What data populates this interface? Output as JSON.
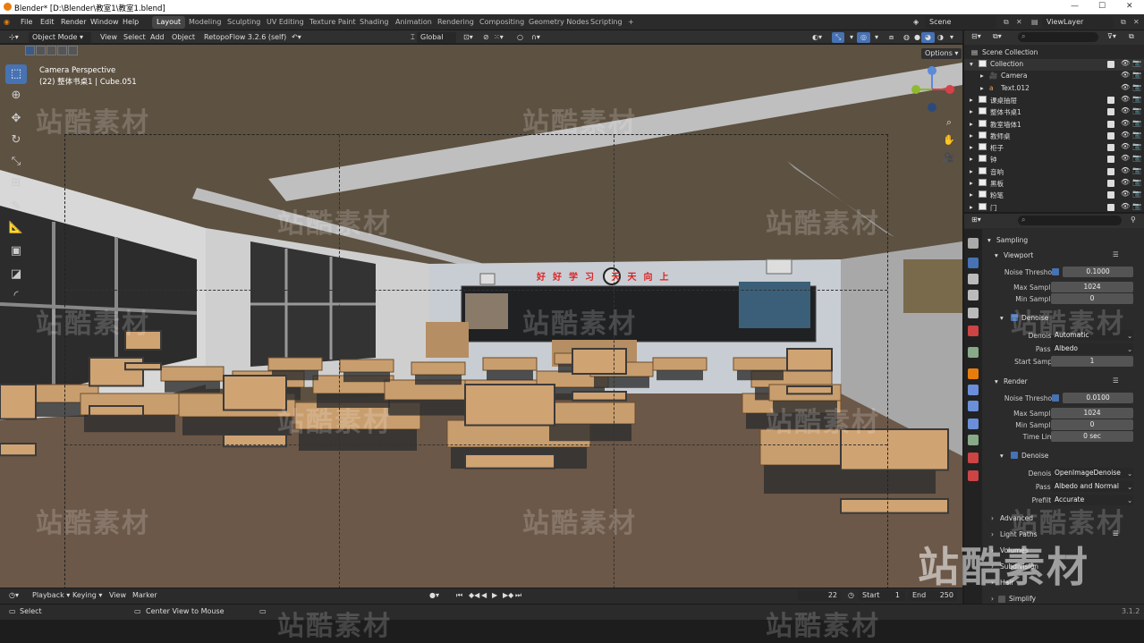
{
  "titlebar": {
    "title": "Blender* [D:\\Blender\\教室1\\教室1.blend]"
  },
  "menu": {
    "items": [
      "File",
      "Edit",
      "Render",
      "Window",
      "Help"
    ]
  },
  "workspaces": [
    "Layout",
    "Modeling",
    "Sculpting",
    "UV Editing",
    "Texture Paint",
    "Shading",
    "Animation",
    "Rendering",
    "Compositing",
    "Geometry Nodes",
    "Scripting"
  ],
  "scene": {
    "label": "Scene",
    "view_layer": "ViewLayer"
  },
  "viewport_header": {
    "mode": "Object Mode",
    "view": "View",
    "select": "Select",
    "add": "Add",
    "object": "Object",
    "addon": "RetopoFlow 3.2.6 (self)",
    "orientation": "Global",
    "options": "Options"
  },
  "viewport": {
    "camera_label": "Camera Perspective",
    "object_label": "(22) 整体书桌1 | Cube.051",
    "board_text": "好好学习 天天向上"
  },
  "outliner": {
    "root": "Scene Collection",
    "rows": [
      {
        "name": "Collection"
      },
      {
        "name": "Camera"
      },
      {
        "name": "Text.012"
      },
      {
        "name": "课桌抽屉"
      },
      {
        "name": "整体书桌1"
      },
      {
        "name": "教室墙体1"
      },
      {
        "name": "教师桌"
      },
      {
        "name": "柜子"
      },
      {
        "name": "钟"
      },
      {
        "name": "音响"
      },
      {
        "name": "黑板"
      },
      {
        "name": "粉笔"
      },
      {
        "name": "门"
      }
    ]
  },
  "properties": {
    "sampling": "Sampling",
    "viewport": "Viewport",
    "vp_noise_threshold_label": "Noise Threshold",
    "vp_noise_threshold": "0.1000",
    "vp_max_samples_label": "Max Samples",
    "vp_max_samples": "1024",
    "vp_min_samples_label": "Min Samples",
    "vp_min_samples": "0",
    "vp_denoise": "Denoise",
    "vp_denoiser_label": "Denoiser",
    "vp_denoiser": "Automatic",
    "vp_passes_label": "Passes",
    "vp_passes": "Albedo",
    "vp_start_sample_label": "Start Sample",
    "vp_start_sample": "1",
    "render": "Render",
    "r_noise_threshold_label": "Noise Threshold",
    "r_noise_threshold": "0.0100",
    "r_max_samples_label": "Max Samples",
    "r_max_samples": "1024",
    "r_min_samples_label": "Min Samples",
    "r_min_samples": "0",
    "r_time_limit_label": "Time Limit",
    "r_time_limit": "0 sec",
    "r_denoise": "Denoise",
    "r_denoiser_label": "Denoiser",
    "r_denoiser": "OpenImageDenoise",
    "r_passes_label": "Passes",
    "r_passes": "Albedo and Normal",
    "r_prefilter_label": "Prefilter",
    "r_prefilter": "Accurate",
    "advanced": "Advanced",
    "light_paths": "Light Paths",
    "volumes": "Volumes",
    "subdivision": "Subdivision",
    "hair": "Hair",
    "simplify": "Simplify"
  },
  "timeline": {
    "playback": "Playback",
    "keying": "Keying",
    "view": "View",
    "marker": "Marker",
    "current_frame": "22",
    "start_label": "Start",
    "start": "1",
    "end_label": "End",
    "end": "250"
  },
  "statusbar": {
    "select": "Select",
    "center": "Center View to Mouse",
    "version": "3.1.2"
  },
  "watermark": "站酷素材"
}
